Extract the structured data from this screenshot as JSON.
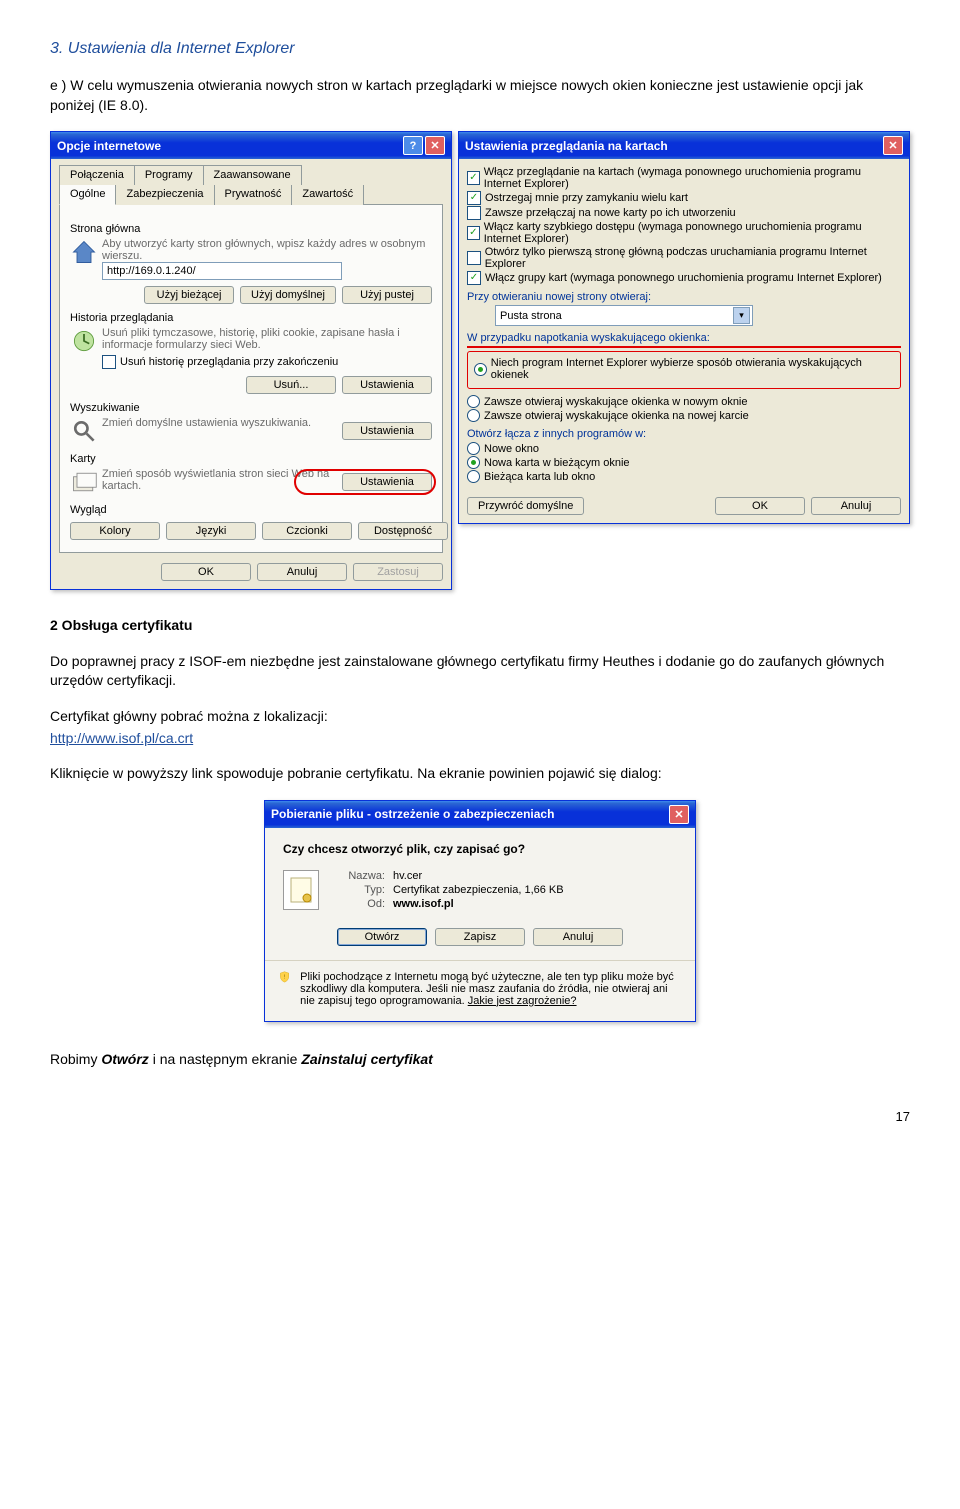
{
  "heading": "3. Ustawienia dla Internet Explorer",
  "intro": "e ) W celu wymuszenia otwierania nowych stron w kartach przeglądarki w miejsce nowych okien konieczne jest ustawienie opcji jak poniżej (IE 8.0).",
  "opcje": {
    "title": "Opcje internetowe",
    "tabs_row1": [
      "Połączenia",
      "Programy",
      "Zaawansowane"
    ],
    "tabs_row2": [
      "Ogólne",
      "Zabezpieczenia",
      "Prywatność",
      "Zawartość"
    ],
    "strona_glowna_label": "Strona główna",
    "strona_glowna_desc": "Aby utworzyć karty stron głównych, wpisz każdy adres w osobnym wierszu.",
    "home_url": "http://169.0.1.240/",
    "btn_biezacej": "Użyj bieżącej",
    "btn_domyslnej": "Użyj domyślnej",
    "btn_pustej": "Użyj pustej",
    "historia_label": "Historia przeglądania",
    "historia_desc": "Usuń pliki tymczasowe, historię, pliki cookie, zapisane hasła i informacje formularzy sieci Web.",
    "hist_checkbox": "Usuń historię przeglądania przy zakończeniu",
    "btn_usun": "Usuń...",
    "btn_ustaw": "Ustawienia",
    "wysz_label": "Wyszukiwanie",
    "wysz_desc": "Zmień domyślne ustawienia wyszukiwania.",
    "karty_label": "Karty",
    "karty_desc": "Zmień sposób wyświetlania stron sieci Web na kartach.",
    "wyglad_label": "Wygląd",
    "kolory": "Kolory",
    "jezyki": "Języki",
    "czcionki": "Czcionki",
    "dostep": "Dostępność",
    "ok": "OK",
    "anuluj": "Anuluj",
    "zastosuj": "Zastosuj"
  },
  "karty": {
    "title": "Ustawienia przeglądania na kartach",
    "chk1": "Włącz przeglądanie na kartach (wymaga ponownego uruchomienia programu Internet Explorer)",
    "chk2": "Ostrzegaj mnie przy zamykaniu wielu kart",
    "chk3": "Zawsze przełączaj na nowe karty po ich utworzeniu",
    "chk4": "Włącz karty szybkiego dostępu (wymaga ponownego uruchomienia programu Internet Explorer)",
    "chk5": "Otwórz tylko pierwszą stronę główną podczas uruchamiania programu Internet Explorer",
    "chk6": "Włącz grupy kart (wymaga ponownego uruchomienia programu Internet Explorer)",
    "h1": "Przy otwieraniu nowej strony otwieraj:",
    "combo": "Pusta strona",
    "h2": "W przypadku napotkania wyskakującego okienka:",
    "r1": "Niech program Internet Explorer wybierze sposób otwierania wyskakujących okienek",
    "r2": "Zawsze otwieraj wyskakujące okienka w nowym oknie",
    "r3": "Zawsze otwieraj wyskakujące okienka na nowej karcie",
    "h3": "Otwórz łącza z innych programów w:",
    "r4": "Nowe okno",
    "r5": "Nowa karta w bieżącym oknie",
    "r6": "Bieżąca karta lub okno",
    "przywroc": "Przywróć domyślne",
    "ok": "OK",
    "anuluj": "Anuluj"
  },
  "cert": {
    "h": "2 Obsługa certyfikatu",
    "p1": "Do poprawnej pracy z ISOF-em niezbędne jest zainstalowane głównego certyfikatu firmy Heuthes i dodanie go do zaufanych głównych urzędów certyfikacji.",
    "p2": "Certyfikat główny pobrać można z  lokalizacji:",
    "link": "http://www.isof.pl/ca.crt",
    "p3": "Kliknięcie w powyższy link spowoduje pobranie certyfikatu. Na ekranie powinien pojawić się dialog:"
  },
  "dl": {
    "title": "Pobieranie pliku - ostrzeżenie o zabezpieczeniach",
    "q": "Czy chcesz otworzyć plik, czy zapisać go?",
    "nazwa_k": "Nazwa:",
    "nazwa_v": "hv.cer",
    "typ_k": "Typ:",
    "typ_v": "Certyfikat zabezpieczenia, 1,66 KB",
    "od_k": "Od:",
    "od_v": "www.isof.pl",
    "otworz": "Otwórz",
    "zapisz": "Zapisz",
    "anuluj": "Anuluj",
    "warn": "Pliki pochodzące z Internetu mogą być użyteczne, ale ten typ pliku może być szkodliwy dla komputera. Jeśli nie masz zaufania do źródła, nie otwieraj ani nie zapisuj tego oprogramowania. ",
    "warnlink": "Jakie jest zagrożenie?"
  },
  "foot": {
    "line": "Robimy Otwórz i na następnym ekranie Zainstaluj certyfikat",
    "r_pre": "Robimy ",
    "r_b1": "Otwórz",
    "r_mid": " i na następnym ekranie ",
    "r_b2": "Zainstaluj certyfikat",
    "pg": "17"
  }
}
